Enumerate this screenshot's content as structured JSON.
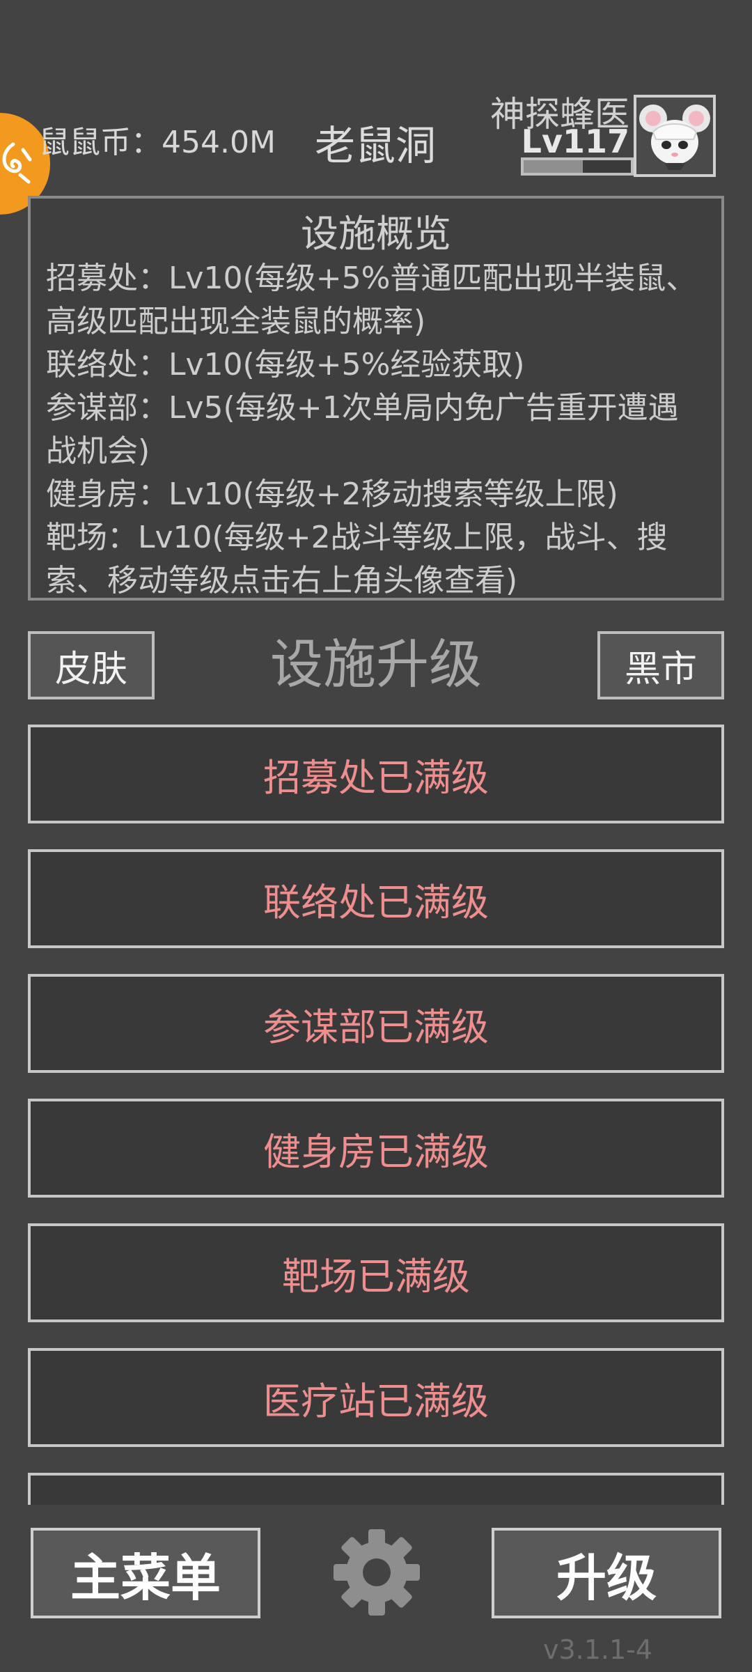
{
  "header": {
    "coins_text": "鼠鼠币：454.0M",
    "title": "老鼠洞",
    "player_name": "神探蜂医",
    "player_level": "Lv117",
    "xp_progress": 0.55
  },
  "overview": {
    "title": "设施概览",
    "lines": [
      "招募处：Lv10(每级+5%普通匹配出现半装鼠、高级匹配出现全装鼠的概率)",
      "联络处：Lv10(每级+5%经验获取)",
      "参谋部：Lv5(每级+1次单局内免广告重开遭遇战机会)",
      "健身房：Lv10(每级+2移动搜索等级上限)",
      "靶场：Lv10(每级+2战斗等级上限，战斗、搜索、移动等级点击右上角头像查看)"
    ]
  },
  "toolbar": {
    "skin_label": "皮肤",
    "section_title": "设施升级",
    "market_label": "黑市"
  },
  "upgrades": [
    "招募处已满级",
    "联络处已满级",
    "参谋部已满级",
    "健身房已满级",
    "靶场已满级",
    "医疗站已满级",
    ""
  ],
  "bottom": {
    "main_menu_label": "主菜单",
    "upgrade_label": "升级",
    "version": "v3.1.1-4"
  },
  "colors": {
    "background": "#434343",
    "maxed_text": "#ef8e8e",
    "badge": "#f39a1e"
  },
  "icons": [
    "side-badge-icon",
    "mouse-avatar-icon",
    "gear-icon"
  ]
}
